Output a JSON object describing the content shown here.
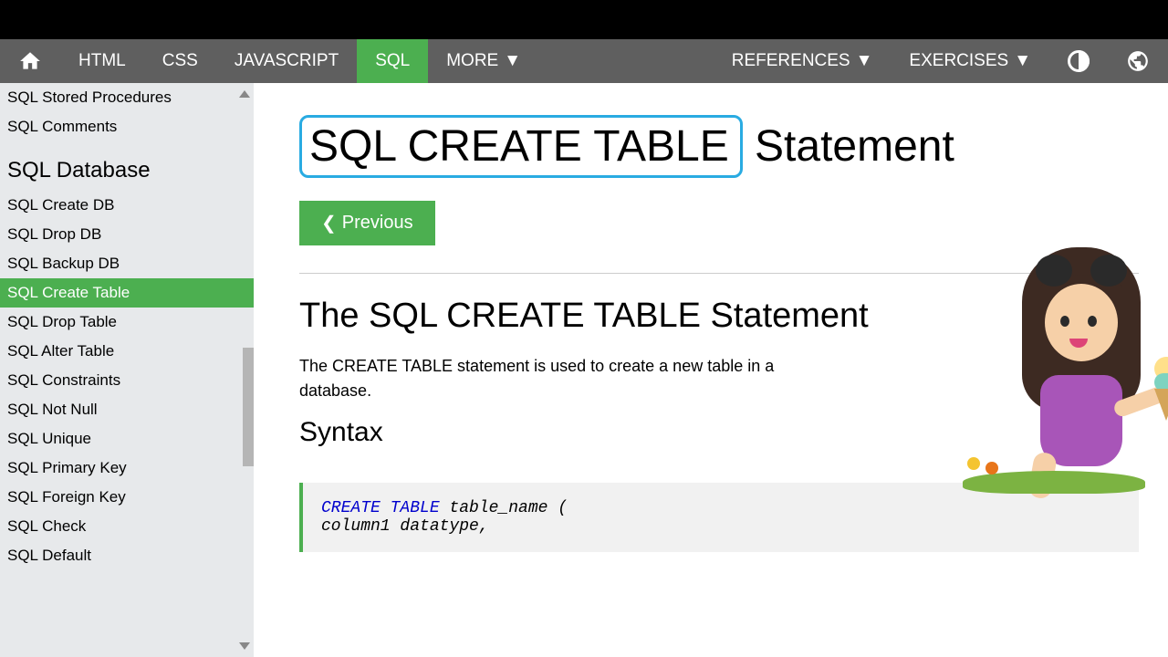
{
  "topnav": {
    "items": [
      "HTML",
      "CSS",
      "JAVASCRIPT",
      "SQL",
      "MORE"
    ],
    "active": 3,
    "right": [
      "REFERENCES",
      "EXERCISES"
    ]
  },
  "sidebar": {
    "top_items": [
      "SQL Stored Procedures",
      "SQL Comments"
    ],
    "heading": "SQL Database",
    "items": [
      "SQL Create DB",
      "SQL Drop DB",
      "SQL Backup DB",
      "SQL Create Table",
      "SQL Drop Table",
      "SQL Alter Table",
      "SQL Constraints",
      "SQL Not Null",
      "SQL Unique",
      "SQL Primary Key",
      "SQL Foreign Key",
      "SQL Check",
      "SQL Default"
    ],
    "active_index": 3
  },
  "page": {
    "title_highlight": "SQL CREATE TABLE",
    "title_rest": " Statement",
    "prev_label": "Previous",
    "section_title": "The SQL CREATE TABLE Statement",
    "section_text": "The CREATE TABLE statement is used to create a new table in a database.",
    "syntax_label": "Syntax",
    "code": {
      "line1_kw": "CREATE TABLE",
      "line1_rest": " table_name (",
      "line2": "    column1 datatype,"
    }
  }
}
